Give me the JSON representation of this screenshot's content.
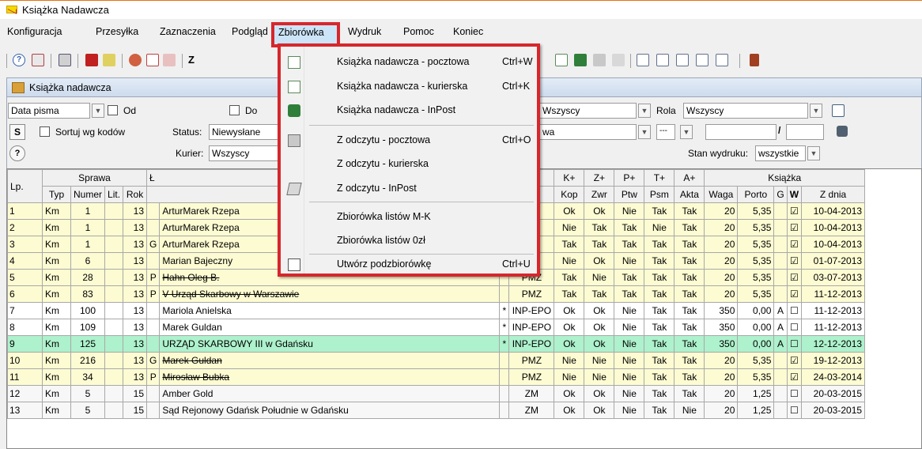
{
  "app": {
    "title": "Książka Nadawcza"
  },
  "menubar": [
    "Konfiguracja",
    "Przesyłka",
    "Zaznaczenia",
    "Podgląd",
    "Zbiorówka",
    "Wydruk",
    "Pomoc",
    "Koniec"
  ],
  "window": {
    "title": "Książka nadawcza"
  },
  "filters": {
    "date_type": "Data pisma",
    "od_label": "Od",
    "do_label": "Do",
    "sort_label": "Sortuj wg kodów",
    "s_button": "S",
    "status_label": "Status:",
    "status_value": "Niewysłane",
    "kurier_label": "Kurier:",
    "kurier_value": "Wszyscy",
    "help_button": "?",
    "wszyscy_value": "Wszyscy",
    "rola_label": "Rola",
    "rola_value": "Wszyscy",
    "wa_value": "wa",
    "dots_value": "---",
    "slash": "/",
    "stan_label": "Stan wydruku:",
    "stan_value": "wszystkie"
  },
  "menu": {
    "items": [
      {
        "label": "Książka nadawcza - pocztowa",
        "shortcut": "Ctrl+W",
        "icon": "book-icon"
      },
      {
        "label": "Książka nadawcza - kurierska",
        "shortcut": "Ctrl+K",
        "icon": "book-icon"
      },
      {
        "label": "Książka nadawcza - InPost",
        "shortcut": "",
        "icon": "inpost-book-icon"
      },
      {
        "label": "Z odczytu - pocztowa",
        "shortcut": "Ctrl+O",
        "icon": "scan-icon"
      },
      {
        "label": "Z odczytu - kurierska",
        "shortcut": "",
        "icon": ""
      },
      {
        "label": "Z odczytu - InPost",
        "shortcut": "",
        "icon": "read-icon"
      },
      {
        "label": "Zbiorówka listów M-K",
        "shortcut": "",
        "icon": ""
      },
      {
        "label": "Zbiorówka listów 0zł",
        "shortcut": "",
        "icon": ""
      },
      {
        "label": "Utwórz podzbiorówkę",
        "shortcut": "Ctrl+U",
        "icon": "subset-icon"
      }
    ]
  },
  "table": {
    "group_headers": {
      "lp": "Lp.",
      "sprawa": "Sprawa",
      "adresat": "Ł",
      "kplus": "K+",
      "zplus": "Z+",
      "pplus": "P+",
      "tplus": "T+",
      "aplus": "A+",
      "ksiazka": "Książka"
    },
    "sub_headers": {
      "typ": "Typ",
      "numer": "Numer",
      "lit": "Lit.",
      "rok": "Rok",
      "kop": "Kop",
      "zwr": "Zwr",
      "ptw": "Ptw",
      "psm": "Psm",
      "akta": "Akta",
      "waga": "Waga",
      "porto": "Porto",
      "g": "G",
      "w": "W",
      "zdnia": "Z dnia"
    },
    "rows": [
      {
        "lp": "1",
        "typ": "Km",
        "numer": "1",
        "lit": "",
        "rok": "13",
        "flag": "",
        "name": "ArturMarek Rzepa",
        "strike": false,
        "star": "",
        "rodz": "",
        "kop": "Ok",
        "zwr": "Ok",
        "ptw": "Nie",
        "psm": "Tak",
        "akta": "Tak",
        "waga": "20",
        "porto": "5,35",
        "g": "",
        "w": "☑",
        "zdnia": "10-04-2013",
        "color": "yellow"
      },
      {
        "lp": "2",
        "typ": "Km",
        "numer": "1",
        "lit": "",
        "rok": "13",
        "flag": "",
        "name": "ArturMarek Rzepa",
        "strike": false,
        "star": "",
        "rodz": "",
        "kop": "Nie",
        "zwr": "Tak",
        "ptw": "Tak",
        "psm": "Nie",
        "akta": "Tak",
        "waga": "20",
        "porto": "5,35",
        "g": "",
        "w": "☑",
        "zdnia": "10-04-2013",
        "color": "yellow"
      },
      {
        "lp": "3",
        "typ": "Km",
        "numer": "1",
        "lit": "",
        "rok": "13",
        "flag": "G",
        "name": "ArturMarek Rzepa",
        "strike": false,
        "star": "",
        "rodz": "",
        "kop": "Tak",
        "zwr": "Tak",
        "ptw": "Tak",
        "psm": "Tak",
        "akta": "Tak",
        "waga": "20",
        "porto": "5,35",
        "g": "",
        "w": "☑",
        "zdnia": "10-04-2013",
        "color": "yellow"
      },
      {
        "lp": "4",
        "typ": "Km",
        "numer": "6",
        "lit": "",
        "rok": "13",
        "flag": "",
        "name": "Marian Bajeczny",
        "strike": false,
        "star": "",
        "rodz": "",
        "kop": "Nie",
        "zwr": "Ok",
        "ptw": "Nie",
        "psm": "Tak",
        "akta": "Tak",
        "waga": "20",
        "porto": "5,35",
        "g": "",
        "w": "☑",
        "zdnia": "01-07-2013",
        "color": "yellow"
      },
      {
        "lp": "5",
        "typ": "Km",
        "numer": "28",
        "lit": "",
        "rok": "13",
        "flag": "P",
        "name": "Hahn Oleg B.",
        "strike": true,
        "star": "",
        "rodz": "PMZ",
        "kop": "Tak",
        "zwr": "Nie",
        "ptw": "Tak",
        "psm": "Tak",
        "akta": "Tak",
        "waga": "20",
        "porto": "5,35",
        "g": "",
        "w": "☑",
        "zdnia": "03-07-2013",
        "color": "yellow"
      },
      {
        "lp": "6",
        "typ": "Km",
        "numer": "83",
        "lit": "",
        "rok": "13",
        "flag": "P",
        "name": "V Urząd Skarbowy w Warszawie",
        "strike": true,
        "star": "",
        "rodz": "PMZ",
        "kop": "Tak",
        "zwr": "Tak",
        "ptw": "Tak",
        "psm": "Tak",
        "akta": "Tak",
        "waga": "20",
        "porto": "5,35",
        "g": "",
        "w": "☑",
        "zdnia": "11-12-2013",
        "color": "yellow"
      },
      {
        "lp": "7",
        "typ": "Km",
        "numer": "100",
        "lit": "",
        "rok": "13",
        "flag": "",
        "name": "Mariola Anielska",
        "strike": false,
        "star": "*",
        "rodz": "INP-EPO",
        "kop": "Ok",
        "zwr": "Ok",
        "ptw": "Nie",
        "psm": "Tak",
        "akta": "Tak",
        "waga": "350",
        "porto": "0,00",
        "g": "A",
        "w": "☐",
        "zdnia": "11-12-2013",
        "color": "white"
      },
      {
        "lp": "8",
        "typ": "Km",
        "numer": "109",
        "lit": "",
        "rok": "13",
        "flag": "",
        "name": "Marek Guldan",
        "strike": false,
        "star": "*",
        "rodz": "INP-EPO",
        "kop": "Ok",
        "zwr": "Ok",
        "ptw": "Nie",
        "psm": "Tak",
        "akta": "Tak",
        "waga": "350",
        "porto": "0,00",
        "g": "A",
        "w": "☐",
        "zdnia": "11-12-2013",
        "color": "white"
      },
      {
        "lp": "9",
        "typ": "Km",
        "numer": "125",
        "lit": "",
        "rok": "13",
        "flag": "",
        "name": "URZĄD SKARBOWY III w Gdańsku",
        "strike": false,
        "star": "*",
        "rodz": "INP-EPO",
        "kop": "Ok",
        "zwr": "Ok",
        "ptw": "Nie",
        "psm": "Tak",
        "akta": "Tak",
        "waga": "350",
        "porto": "0,00",
        "g": "A",
        "w": "☐",
        "zdnia": "12-12-2013",
        "color": "green"
      },
      {
        "lp": "10",
        "typ": "Km",
        "numer": "216",
        "lit": "",
        "rok": "13",
        "flag": "G",
        "name": "Marek Guldan",
        "strike": true,
        "star": "",
        "rodz": "PMZ",
        "kop": "Nie",
        "zwr": "Nie",
        "ptw": "Nie",
        "psm": "Tak",
        "akta": "Tak",
        "waga": "20",
        "porto": "5,35",
        "g": "",
        "w": "☑",
        "zdnia": "19-12-2013",
        "color": "yellow"
      },
      {
        "lp": "11",
        "typ": "Km",
        "numer": "34",
        "lit": "",
        "rok": "13",
        "flag": "P",
        "name": "Mirosław Bubka",
        "strike": true,
        "star": "",
        "rodz": "PMZ",
        "kop": "Nie",
        "zwr": "Nie",
        "ptw": "Nie",
        "psm": "Tak",
        "akta": "Tak",
        "waga": "20",
        "porto": "5,35",
        "g": "",
        "w": "☑",
        "zdnia": "24-03-2014",
        "color": "yellow"
      },
      {
        "lp": "12",
        "typ": "Km",
        "numer": "5",
        "lit": "",
        "rok": "15",
        "flag": "",
        "name": "Amber Gold",
        "strike": false,
        "star": "",
        "rodz": "ZM",
        "kop": "Ok",
        "zwr": "Ok",
        "ptw": "Nie",
        "psm": "Tak",
        "akta": "Tak",
        "waga": "20",
        "porto": "1,25",
        "g": "",
        "w": "☐",
        "zdnia": "20-03-2015",
        "color": "gray"
      },
      {
        "lp": "13",
        "typ": "Km",
        "numer": "5",
        "lit": "",
        "rok": "15",
        "flag": "",
        "name": "Sąd Rejonowy Gdańsk Południe w Gdańsku",
        "strike": false,
        "star": "",
        "rodz": "ZM",
        "kop": "Ok",
        "zwr": "Ok",
        "ptw": "Nie",
        "psm": "Tak",
        "akta": "Nie",
        "waga": "20",
        "porto": "1,25",
        "g": "",
        "w": "☐",
        "zdnia": "20-03-2015",
        "color": "gray"
      }
    ]
  }
}
